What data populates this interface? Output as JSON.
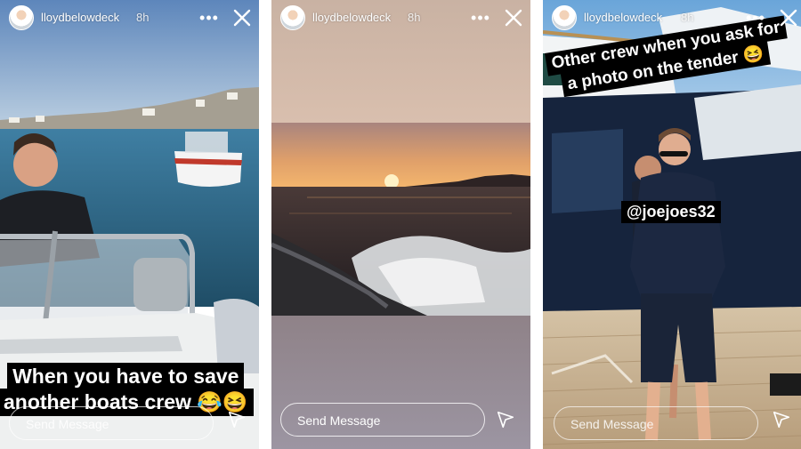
{
  "stories": [
    {
      "username": "lloydbelowdeck",
      "time": "8h",
      "more_icon": "more-horizontal-icon",
      "close_icon": "close-icon",
      "caption": [
        "When you have to save",
        "another boats crew"
      ],
      "caption_emojis": [
        "😂",
        "😆"
      ],
      "send_placeholder": "Send Message"
    },
    {
      "username": "lloydbelowdeck",
      "time": "8h",
      "more_icon": "more-horizontal-icon",
      "close_icon": "close-icon",
      "send_placeholder": "Send Message"
    },
    {
      "username": "lloydbelowdeck",
      "time": "8h",
      "more_icon": "more-horizontal-icon",
      "close_icon": "close-icon",
      "caption": [
        "Other crew when you ask for",
        "a photo on the tender"
      ],
      "caption_emojis": [
        "😆"
      ],
      "mention": "@joejoes32",
      "send_placeholder": "Send Message"
    }
  ],
  "colors": {
    "text": "#ffffff",
    "caption_bg": "#000000",
    "sea": "#2c6f91",
    "sunset": "#f0a35a"
  }
}
